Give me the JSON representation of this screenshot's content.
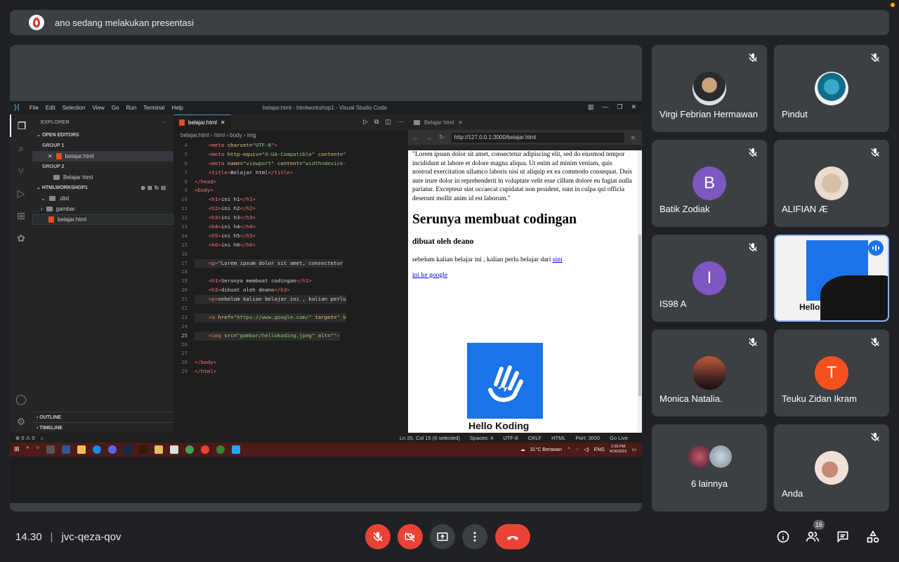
{
  "banner": {
    "text": "ano sedang melakukan presentasi"
  },
  "vscode": {
    "menu": [
      "File",
      "Edit",
      "Selection",
      "View",
      "Go",
      "Run",
      "Terminal",
      "Help"
    ],
    "window_title": "belajar.html - htmlworkshop1 - Visual Studio Code",
    "explorer_title": "EXPLORER",
    "open_editors": "OPEN EDITORS",
    "group1": "GROUP 1",
    "group1_file": "belajar.html",
    "group2": "GROUP 2",
    "group2_file": "Belajar html",
    "workspace": "HTMLWORKSHOP1",
    "tree": [
      ".dist",
      "gambar",
      "belajar.html"
    ],
    "outline": "OUTLINE",
    "timeline": "TIMELINE",
    "tab": "belajar.html",
    "breadcrumb": [
      "belajar.html",
      "html",
      "body",
      "img"
    ],
    "code_lines": [
      {
        "n": "4",
        "html": "<span class='t-tag'>&lt;meta</span> <span class='t-attr'>charset</span>=<span class='t-str'>\"UTF-8\"</span><span class='t-tag'>&gt;</span>"
      },
      {
        "n": "5",
        "html": "<span class='t-tag'>&lt;meta</span> <span class='t-attr'>http-equiv</span>=<span class='t-str'>\"X-UA-Compatible\"</span> <span class='t-attr'>content</span>=<span class='t-str'>\"</span>"
      },
      {
        "n": "6",
        "html": "<span class='t-tag'>&lt;meta</span> <span class='t-attr'>name</span>=<span class='t-str'>\"viewport\"</span> <span class='t-attr'>content</span>=<span class='t-str'>\"width=device-</span>"
      },
      {
        "n": "7",
        "html": "<span class='t-tag'>&lt;title&gt;</span>Belajar html<span class='t-tag'>&lt;/title&gt;</span>"
      },
      {
        "n": "8",
        "html": "<span class='t-tag'>&lt;/head&gt;</span>"
      },
      {
        "n": "9",
        "html": "<span class='t-tag'>&lt;body&gt;</span>"
      },
      {
        "n": "10",
        "html": "<span class='t-tag'>&lt;h1&gt;</span>ini h1<span class='t-tag'>&lt;/h1&gt;</span>"
      },
      {
        "n": "11",
        "html": "<span class='t-tag'>&lt;h2&gt;</span>ini h2<span class='t-tag'>&lt;/h2&gt;</span>"
      },
      {
        "n": "12",
        "html": "<span class='t-tag'>&lt;h3&gt;</span>ini h3<span class='t-tag'>&lt;/h3&gt;</span>"
      },
      {
        "n": "13",
        "html": "<span class='t-tag'>&lt;h4&gt;</span>ini h4<span class='t-tag'>&lt;/h4&gt;</span>"
      },
      {
        "n": "14",
        "html": "<span class='t-tag'>&lt;h5&gt;</span>ini h5<span class='t-tag'>&lt;/h5&gt;</span>"
      },
      {
        "n": "15",
        "html": "<span class='t-tag'>&lt;h6&gt;</span>ini h6<span class='t-tag'>&lt;/h6&gt;</span>"
      },
      {
        "n": "16",
        "html": ""
      },
      {
        "n": "17",
        "html": "<span class='t-tag'>&lt;p&gt;</span>\"Lorem ipsum dolor sit amet, consectetur"
      },
      {
        "n": "18",
        "html": ""
      },
      {
        "n": "19",
        "html": "<span class='t-tag'>&lt;h1&gt;</span>Serunya membuat codingan<span class='t-tag'>&lt;/h1&gt;</span>"
      },
      {
        "n": "20",
        "html": "<span class='t-tag'>&lt;h3&gt;</span>dibuat oleh deano<span class='t-tag'>&lt;/h3&gt;</span>"
      },
      {
        "n": "21",
        "html": "<span class='t-tag'>&lt;p&gt;</span>sebelum kalian belajar ini , kalian perlu"
      },
      {
        "n": "22",
        "html": ""
      },
      {
        "n": "23",
        "html": "<span class='t-tag'>&lt;a</span> <span class='t-attr'>href</span>=<span class='t-str'>\"https://www.google.com/\"</span> <span class='t-attr'>target</span>=<span class='t-str'>\"_b</span>"
      },
      {
        "n": "24",
        "html": ""
      },
      {
        "n": "25",
        "html": "<span class='t-tag'>&lt;img</span> <span class='t-attr'>src</span>=<span class='t-str'>\"gambar/hellokoding.jpeg\"</span> <span class='t-attr'>alt</span>=<span class='t-str'>\"\"</span><span class='t-tag'>&gt;</span>"
      },
      {
        "n": "26",
        "html": ""
      },
      {
        "n": "27",
        "html": ""
      },
      {
        "n": "28",
        "html": "<span class='t-tag'>&lt;/body&gt;</span>"
      },
      {
        "n": "29",
        "html": "<span class='t-tag'>&lt;/html&gt;</span>"
      }
    ],
    "preview_tab": "Belajar html",
    "preview_url": "http://127.0.0.1:3000/belajar.html",
    "page": {
      "lorem": "\"Lorem ipsum dolor sit amet, consectetur adipiscing elit, sed do eiusmod tempor incididunt ut labore et dolore magna aliqua. Ut enim ad minim veniam, quis nostrud exercitation ullamco laboris nisi ut aliquip ex ea commodo consequat. Duis aute irure dolor in reprehenderit in voluptate velit esse cillum dolore eu fugiat nulla pariatur. Excepteur sint occaecat cupidatat non proident, sunt in culpa qui officia deserunt mollit anim id est laborum.\"",
      "h1": "Serunya membuat codingan",
      "h3": "dibuat oleh deano",
      "p": "sebelum kalian belajar ini , kalian perlu belajar dari",
      "link1": "sini",
      "link2": "ini ke google",
      "logo_text": "Hello Koding"
    },
    "status_left": [
      "⊗ 0 ⚠ 0"
    ],
    "status_right": [
      "Ln 25, Col 15 (6 selected)",
      "Spaces: 4",
      "UTF-8",
      "CRLF",
      "HTML",
      "Port: 3000",
      "Go Live"
    ],
    "taskbar_weather": "31°C Berawan",
    "taskbar_lang": "ENG",
    "taskbar_time": "2:30 PM",
    "taskbar_date": "4/16/2022"
  },
  "participants": [
    {
      "name": "Virgi Febrian Hermawan",
      "type": "photo"
    },
    {
      "name": "Pindut",
      "type": "photo"
    },
    {
      "name": "Batik Zodiak",
      "initial": "B",
      "color": "#7e57c2"
    },
    {
      "name": "ALIFIAN Æ",
      "type": "photo"
    },
    {
      "name": "IS98 A",
      "initial": "I",
      "color": "#7e57c2"
    },
    {
      "name": "Monica Natalia.",
      "type": "photo"
    },
    {
      "name": "Teuku Zidan Ikram",
      "initial": "T",
      "color": "#f4511e"
    },
    {
      "name": "6 lainnya",
      "type": "group"
    },
    {
      "name": "Anda",
      "type": "photo"
    }
  ],
  "presenter_tile_text": "Hello",
  "meeting": {
    "time": "14.30",
    "code": "jvc-qeza-qov"
  },
  "people_count": "16",
  "colors": {
    "bg": "#202124",
    "tile": "#3c4043",
    "red": "#ea4335",
    "accent": "#8ab4f8"
  }
}
